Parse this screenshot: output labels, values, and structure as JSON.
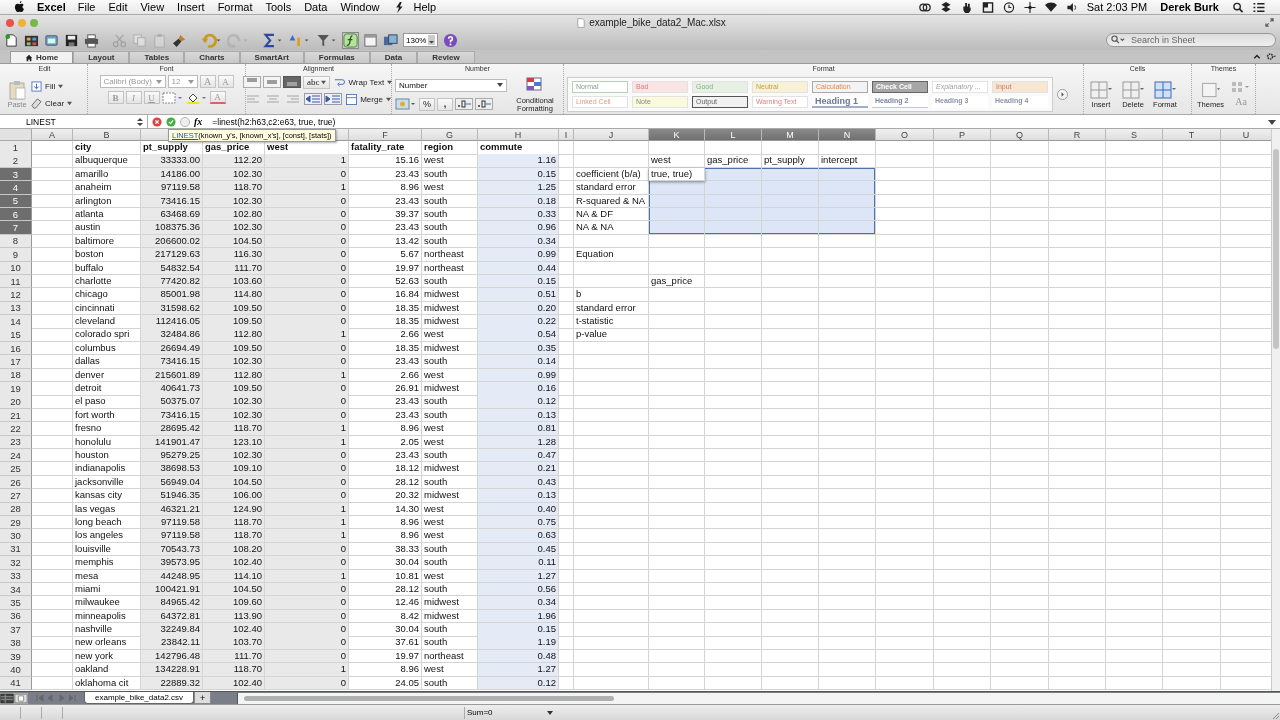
{
  "menu_bar": {
    "app": "Excel",
    "items": [
      "File",
      "Edit",
      "View",
      "Insert",
      "Format",
      "Tools",
      "Data",
      "Window",
      "Help"
    ],
    "clock": "Sat 2:03 PM",
    "user": "Derek Burk"
  },
  "window": {
    "title": "example_bike_data2_Mac.xlsx"
  },
  "toolbar": {
    "zoom": "130%",
    "search": {
      "placeholder": "Search in Sheet"
    }
  },
  "ribbon_tabs": [
    {
      "label": "Home",
      "selected": true
    },
    {
      "label": "Layout",
      "selected": false
    },
    {
      "label": "Tables",
      "selected": false
    },
    {
      "label": "Charts",
      "selected": false
    },
    {
      "label": "SmartArt",
      "selected": false
    },
    {
      "label": "Formulas",
      "selected": false
    },
    {
      "label": "Data",
      "selected": false
    },
    {
      "label": "Review",
      "selected": false
    }
  ],
  "ribbon": {
    "edit": {
      "title": "Edit",
      "paste": "Paste",
      "fill": "Fill",
      "clear": "Clear"
    },
    "font": {
      "title": "Font",
      "family": "Calibri (Body)",
      "size": "12",
      "grow": "A",
      "shrink": "A",
      "bold": "B",
      "italic": "I",
      "underline": "U",
      "font_color": "A"
    },
    "alignment": {
      "title": "Alignment",
      "orientation": "abc",
      "wrap": "Wrap Text",
      "merge": "Merge"
    },
    "number": {
      "title": "Number",
      "format": "Number",
      "percent": "%",
      "comma": ",",
      "conditional": "Conditional Formatting"
    },
    "format": {
      "title": "Format",
      "styles": [
        "Normal",
        "Bad",
        "Good",
        "Neutral",
        "Calculation",
        "Check Cell",
        "Explanatory ...",
        "Input",
        "Linked Cell",
        "Note",
        "Output",
        "Warning Text",
        "Heading 1",
        "Heading 2",
        "Heading 3",
        "Heading 4"
      ]
    },
    "cells": {
      "title": "Cells",
      "buttons": [
        "Insert",
        "Delete",
        "Format"
      ]
    },
    "themes": {
      "title": "Themes",
      "button": "Themes",
      "fonts": "Aa"
    }
  },
  "formula_bar": {
    "name_box": "LINEST",
    "fx": "fx",
    "formula": "=linest(h2:h63,c2:e63, true, true)",
    "tooltip": {
      "function": "LINEST",
      "args": "(known_y's, [known_x's], [const], [stats])"
    }
  },
  "grid": {
    "editing": true,
    "columns": [
      {
        "letter": "A",
        "selected": false
      },
      {
        "letter": "B",
        "selected": false
      },
      {
        "numeric": true,
        "selected": false,
        "color": "#e9e9e9"
      },
      {
        "numeric": true,
        "color": "#e9e9e9"
      },
      {
        "numeric": true,
        "selected": false,
        "color": "#e9e9e9"
      },
      {
        "letter": "F",
        "numeric": true,
        "selected": false
      },
      {
        "letter": "G",
        "selected": false
      },
      {
        "letter": "H",
        "numeric": true,
        "selected": false,
        "color": "#e4ebf7"
      },
      {
        "letter": "I",
        "selected": false
      },
      {
        "letter": "J",
        "selected": false
      },
      {
        "letter": "K",
        "selected": true
      },
      {
        "letter": "L",
        "selected": true
      },
      {
        "letter": "M",
        "selected": true
      },
      {
        "letter": "N",
        "selected": true
      },
      {
        "letter": "O",
        "selected": false
      },
      {
        "letter": "P",
        "selected": false
      },
      {
        "letter": "Q",
        "selected": false
      },
      {
        "letter": "R",
        "selected": false
      },
      {
        "letter": "S",
        "selected": false
      },
      {
        "letter": "T",
        "selected": false
      },
      {
        "letter": "U",
        "selected": false
      }
    ],
    "rows": [
      {
        "number": "1",
        "kind": "header",
        "selected": false,
        "cells": {
          "1": "city",
          "2": "pt_supply",
          "3": "gas_price",
          "4": "west",
          "5": "fatality_rate",
          "6": "region",
          "7": "commute"
        }
      },
      {
        "number": "2",
        "kind": "data",
        "selected": false,
        "cells": {
          "1": "albuquerque",
          "2": "33333.00",
          "3": "112.20",
          "4": "1",
          "5": "15.16",
          "6": "west",
          "7": "1.16",
          "10": "west",
          "11": "gas_price",
          "12": "pt_supply",
          "13": "intercept"
        }
      },
      {
        "number": "3",
        "kind": "data",
        "selected": true,
        "cells": {
          "1": "amarillo",
          "2": "14186.00",
          "3": "102.30",
          "4": "0",
          "5": "23.43",
          "6": "south",
          "7": "0.15",
          "9": "coefficient (b/a)",
          "10": "true, true)"
        }
      },
      {
        "number": "4",
        "kind": "data",
        "selected": true,
        "cells": {
          "1": "anaheim",
          "2": "97119.58",
          "3": "118.70",
          "4": "1",
          "5": "8.96",
          "6": "west",
          "7": "1.25",
          "9": "standard error"
        }
      },
      {
        "number": "5",
        "kind": "data",
        "selected": true,
        "cells": {
          "1": "arlington",
          "2": "73416.15",
          "3": "102.30",
          "4": "0",
          "5": "23.43",
          "6": "south",
          "7": "0.18",
          "9": "R-squared & NA"
        }
      },
      {
        "number": "6",
        "kind": "data",
        "selected": true,
        "cells": {
          "1": "atlanta",
          "2": "63468.69",
          "3": "102.80",
          "4": "0",
          "5": "39.37",
          "6": "south",
          "7": "0.33",
          "9": "NA & DF"
        }
      },
      {
        "number": "7",
        "kind": "data",
        "selected": true,
        "cells": {
          "1": "austin",
          "2": "108375.36",
          "3": "102.30",
          "4": "0",
          "5": "23.43",
          "6": "south",
          "7": "0.96",
          "9": "NA & NA"
        }
      },
      {
        "number": "8",
        "kind": "data",
        "selected": false,
        "cells": {
          "1": "baltimore",
          "2": "206600.02",
          "3": "104.50",
          "4": "0",
          "5": "13.42",
          "6": "south",
          "7": "0.34"
        }
      },
      {
        "number": "9",
        "kind": "data",
        "selected": false,
        "cells": {
          "1": "boston",
          "2": "217129.63",
          "3": "116.30",
          "4": "0",
          "5": "5.67",
          "6": "northeast",
          "7": "0.99",
          "9": "Equation"
        }
      },
      {
        "number": "10",
        "kind": "data",
        "selected": false,
        "cells": {
          "1": "buffalo",
          "2": "54832.54",
          "3": "111.70",
          "4": "0",
          "5": "19.97",
          "6": "northeast",
          "7": "0.44"
        }
      },
      {
        "number": "11",
        "kind": "data",
        "selected": false,
        "cells": {
          "1": "charlotte",
          "2": "77420.82",
          "3": "103.60",
          "4": "0",
          "5": "52.63",
          "6": "south",
          "7": "0.15",
          "10": "gas_price"
        }
      },
      {
        "number": "12",
        "kind": "data",
        "selected": false,
        "cells": {
          "1": "chicago",
          "2": "85001.98",
          "3": "114.80",
          "4": "0",
          "5": "16.84",
          "6": "midwest",
          "7": "0.51",
          "9": "b"
        }
      },
      {
        "number": "13",
        "kind": "data",
        "selected": false,
        "cells": {
          "1": "cincinnati",
          "2": "31598.62",
          "3": "109.50",
          "4": "0",
          "5": "18.35",
          "6": "midwest",
          "7": "0.20",
          "9": "standard error"
        }
      },
      {
        "number": "14",
        "kind": "data",
        "selected": false,
        "cells": {
          "1": "cleveland",
          "2": "112416.05",
          "3": "109.50",
          "4": "0",
          "5": "18.35",
          "6": "midwest",
          "7": "0.22",
          "9": "t-statistic"
        }
      },
      {
        "number": "15",
        "kind": "data",
        "selected": false,
        "cells": {
          "1": "colorado spri",
          "2": "32484.86",
          "3": "112.80",
          "4": "1",
          "5": "2.66",
          "6": "west",
          "7": "0.54",
          "9": "p-value"
        }
      },
      {
        "number": "16",
        "kind": "data",
        "selected": false,
        "cells": {
          "1": "columbus",
          "2": "26694.49",
          "3": "109.50",
          "4": "0",
          "5": "18.35",
          "6": "midwest",
          "7": "0.35"
        }
      },
      {
        "number": "17",
        "kind": "data",
        "selected": false,
        "cells": {
          "1": "dallas",
          "2": "73416.15",
          "3": "102.30",
          "4": "0",
          "5": "23.43",
          "6": "south",
          "7": "0.14"
        }
      },
      {
        "number": "18",
        "kind": "data",
        "selected": false,
        "cells": {
          "1": "denver",
          "2": "215601.89",
          "3": "112.80",
          "4": "1",
          "5": "2.66",
          "6": "west",
          "7": "0.99"
        }
      },
      {
        "number": "19",
        "kind": "data",
        "selected": false,
        "cells": {
          "1": "detroit",
          "2": "40641.73",
          "3": "109.50",
          "4": "0",
          "5": "26.91",
          "6": "midwest",
          "7": "0.16"
        }
      },
      {
        "number": "20",
        "kind": "data",
        "selected": false,
        "cells": {
          "1": "el paso",
          "2": "50375.07",
          "3": "102.30",
          "4": "0",
          "5": "23.43",
          "6": "south",
          "7": "0.12"
        }
      },
      {
        "number": "21",
        "kind": "data",
        "selected": false,
        "cells": {
          "1": "fort worth",
          "2": "73416.15",
          "3": "102.30",
          "4": "0",
          "5": "23.43",
          "6": "south",
          "7": "0.13"
        }
      },
      {
        "number": "22",
        "kind": "data",
        "selected": false,
        "cells": {
          "1": "fresno",
          "2": "28695.42",
          "3": "118.70",
          "4": "1",
          "5": "8.96",
          "6": "west",
          "7": "0.81"
        }
      },
      {
        "number": "23",
        "kind": "data",
        "selected": false,
        "cells": {
          "1": "honolulu",
          "2": "141901.47",
          "3": "123.10",
          "4": "1",
          "5": "2.05",
          "6": "west",
          "7": "1.28"
        }
      },
      {
        "number": "24",
        "kind": "data",
        "selected": false,
        "cells": {
          "1": "houston",
          "2": "95279.25",
          "3": "102.30",
          "4": "0",
          "5": "23.43",
          "6": "south",
          "7": "0.47"
        }
      },
      {
        "number": "25",
        "kind": "data",
        "selected": false,
        "cells": {
          "1": "indianapolis",
          "2": "38698.53",
          "3": "109.10",
          "4": "0",
          "5": "18.12",
          "6": "midwest",
          "7": "0.21"
        }
      },
      {
        "number": "26",
        "kind": "data",
        "selected": false,
        "cells": {
          "1": "jacksonville",
          "2": "56949.04",
          "3": "104.50",
          "4": "0",
          "5": "28.12",
          "6": "south",
          "7": "0.43"
        }
      },
      {
        "number": "27",
        "kind": "data",
        "selected": false,
        "cells": {
          "1": "kansas city",
          "2": "51946.35",
          "3": "106.00",
          "4": "0",
          "5": "20.32",
          "6": "midwest",
          "7": "0.13"
        }
      },
      {
        "number": "28",
        "kind": "data",
        "selected": false,
        "cells": {
          "1": "las vegas",
          "2": "46321.21",
          "3": "124.90",
          "4": "1",
          "5": "14.30",
          "6": "west",
          "7": "0.40"
        }
      },
      {
        "number": "29",
        "kind": "data",
        "selected": false,
        "cells": {
          "1": "long beach",
          "2": "97119.58",
          "3": "118.70",
          "4": "1",
          "5": "8.96",
          "6": "west",
          "7": "0.75"
        }
      },
      {
        "number": "30",
        "kind": "data",
        "selected": false,
        "cells": {
          "1": "los angeles",
          "2": "97119.58",
          "3": "118.70",
          "4": "1",
          "5": "8.96",
          "6": "west",
          "7": "0.63"
        }
      },
      {
        "number": "31",
        "kind": "data",
        "selected": false,
        "cells": {
          "1": "louisville",
          "2": "70543.73",
          "3": "108.20",
          "4": "0",
          "5": "38.33",
          "6": "south",
          "7": "0.45"
        }
      },
      {
        "number": "32",
        "kind": "data",
        "selected": false,
        "cells": {
          "1": "memphis",
          "2": "39573.95",
          "3": "102.40",
          "4": "0",
          "5": "30.04",
          "6": "south",
          "7": "0.11"
        }
      },
      {
        "number": "33",
        "kind": "data",
        "selected": false,
        "cells": {
          "1": "mesa",
          "2": "44248.95",
          "3": "114.10",
          "4": "1",
          "5": "10.81",
          "6": "west",
          "7": "1.27"
        }
      },
      {
        "number": "34",
        "kind": "data",
        "selected": false,
        "cells": {
          "1": "miami",
          "2": "100421.91",
          "3": "104.50",
          "4": "0",
          "5": "28.12",
          "6": "south",
          "7": "0.56"
        }
      },
      {
        "number": "35",
        "kind": "data",
        "selected": false,
        "cells": {
          "1": "milwaukee",
          "2": "84965.42",
          "3": "109.60",
          "4": "0",
          "5": "12.46",
          "6": "midwest",
          "7": "0.34"
        }
      },
      {
        "number": "36",
        "kind": "data",
        "selected": false,
        "cells": {
          "1": "minneapolis",
          "2": "64372.81",
          "3": "113.90",
          "4": "0",
          "5": "8.42",
          "6": "midwest",
          "7": "1.96"
        }
      },
      {
        "number": "37",
        "kind": "data",
        "selected": false,
        "cells": {
          "1": "nashville",
          "2": "32249.84",
          "3": "102.40",
          "4": "0",
          "5": "30.04",
          "6": "south",
          "7": "0.15"
        }
      },
      {
        "number": "38",
        "kind": "data",
        "selected": false,
        "cells": {
          "1": "new orleans",
          "2": "23842.11",
          "3": "103.70",
          "4": "0",
          "5": "37.61",
          "6": "south",
          "7": "1.19"
        }
      },
      {
        "number": "39",
        "kind": "data",
        "selected": false,
        "cells": {
          "1": "new york",
          "2": "142796.48",
          "3": "111.70",
          "4": "0",
          "5": "19.97",
          "6": "northeast",
          "7": "0.48"
        }
      },
      {
        "number": "40",
        "kind": "data",
        "selected": false,
        "cells": {
          "1": "oakland",
          "2": "134228.91",
          "3": "118.70",
          "4": "1",
          "5": "8.96",
          "6": "west",
          "7": "1.27"
        }
      },
      {
        "number": "41",
        "kind": "data",
        "selected": false,
        "cells": {
          "1": "oklahoma cit",
          "2": "22889.32",
          "3": "102.40",
          "4": "0",
          "5": "24.05",
          "6": "south",
          "7": "0.12"
        }
      }
    ]
  },
  "sheet_tabs": [
    {
      "label": "example_bike_data2.csv",
      "selected": true
    }
  ],
  "add_sheet": "+",
  "status_bar": {
    "sum": "Sum=0"
  }
}
